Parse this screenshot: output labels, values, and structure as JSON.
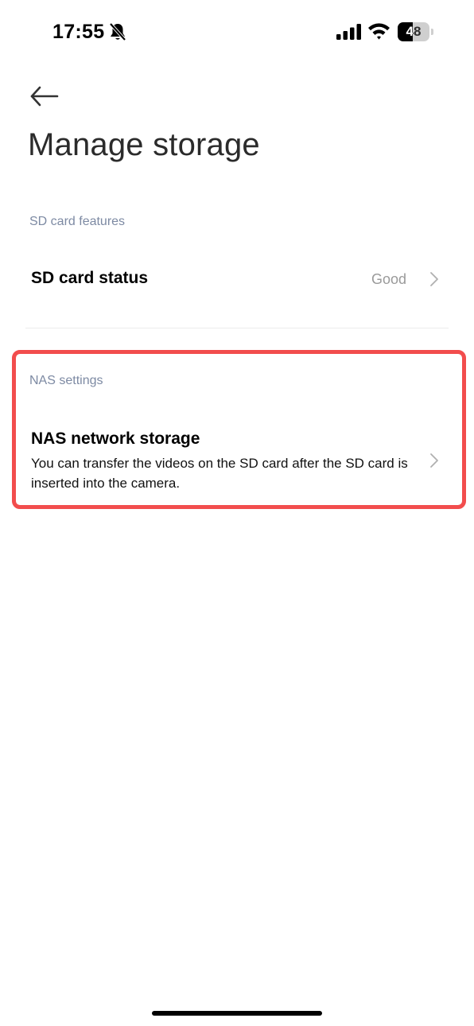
{
  "status_bar": {
    "time": "17:55",
    "battery_level": "48",
    "icons": [
      "bell-off-icon",
      "signal-icon",
      "wifi-icon",
      "battery-icon"
    ]
  },
  "header": {
    "back_icon": "arrow-left-icon",
    "title": "Manage storage"
  },
  "sd_section": {
    "label": "SD card features",
    "items": [
      {
        "title": "SD card status",
        "value": "Good",
        "icon": "chevron-right-icon"
      }
    ]
  },
  "nas_section": {
    "label": "NAS settings",
    "highlight_color": "#f24d4d",
    "items": [
      {
        "title": "NAS network storage",
        "description": "You can transfer the videos on the SD card after the SD card is inserted into the camera.",
        "icon": "chevron-right-icon"
      }
    ]
  },
  "colors": {
    "section_label": "#7d8aa3",
    "value_text": "#9a9a9a",
    "title_text": "#2b2b2b"
  }
}
